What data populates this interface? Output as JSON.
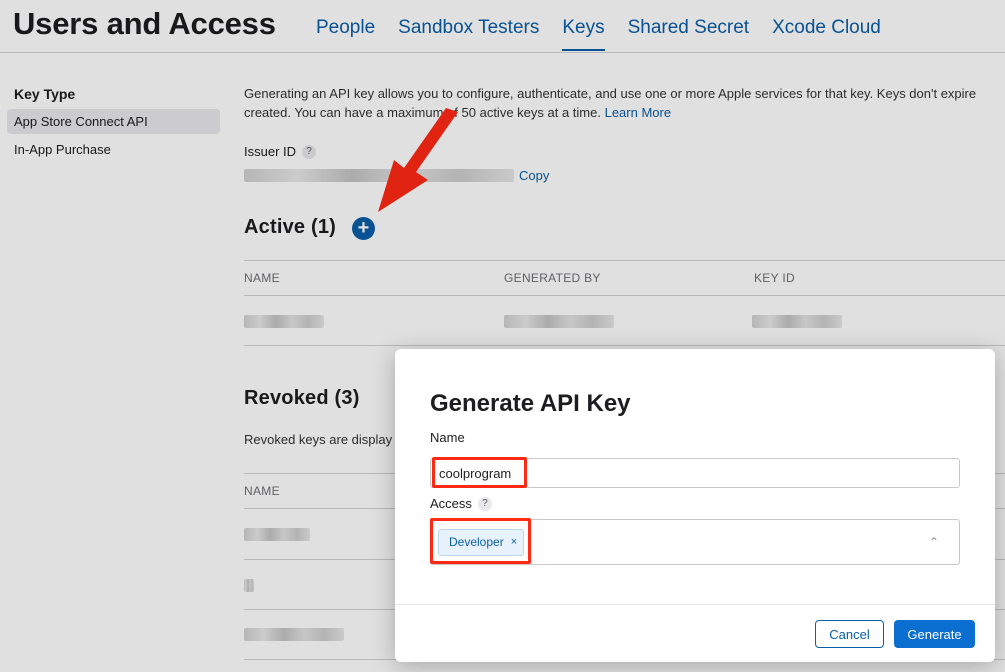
{
  "header": {
    "title": "Users and Access",
    "tabs": [
      {
        "label": "People"
      },
      {
        "label": "Sandbox Testers"
      },
      {
        "label": "Keys",
        "active": true
      },
      {
        "label": "Shared Secret"
      },
      {
        "label": "Xcode Cloud"
      }
    ]
  },
  "sidebar": {
    "heading": "Key Type",
    "items": [
      {
        "label": "App Store Connect API",
        "selected": true
      },
      {
        "label": "In-App Purchase"
      }
    ]
  },
  "main": {
    "intro": "Generating an API key allows you to configure, authenticate, and use one or more Apple services for that key. Keys don't expire created. You can have a maximum of 50 active keys at a time.",
    "learn_more": "Learn More",
    "issuer_label": "Issuer ID",
    "help_glyph": "?",
    "copy_label": "Copy",
    "active_title": "Active (1)",
    "add_glyph": "+",
    "columns": {
      "name": "NAME",
      "generated_by": "GENERATED BY",
      "key_id": "KEY ID"
    },
    "revoked_title": "Revoked (3)",
    "revoked_note": "Revoked keys are display",
    "revoked_name_col": "NAME"
  },
  "modal": {
    "title": "Generate API Key",
    "name_label": "Name",
    "name_value": "coolprogram",
    "access_label": "Access",
    "access_token": "Developer",
    "token_remove": "×",
    "chevron": "⌃",
    "cancel_label": "Cancel",
    "generate_label": "Generate"
  },
  "colors": {
    "link": "#0a5ea8",
    "primary_button": "#0a6fd1",
    "annotation": "#ff2a14"
  },
  "icons": [
    "question-icon",
    "plus-circle-icon",
    "chevron-up-icon",
    "annotation-arrow-icon",
    "close-icon"
  ]
}
